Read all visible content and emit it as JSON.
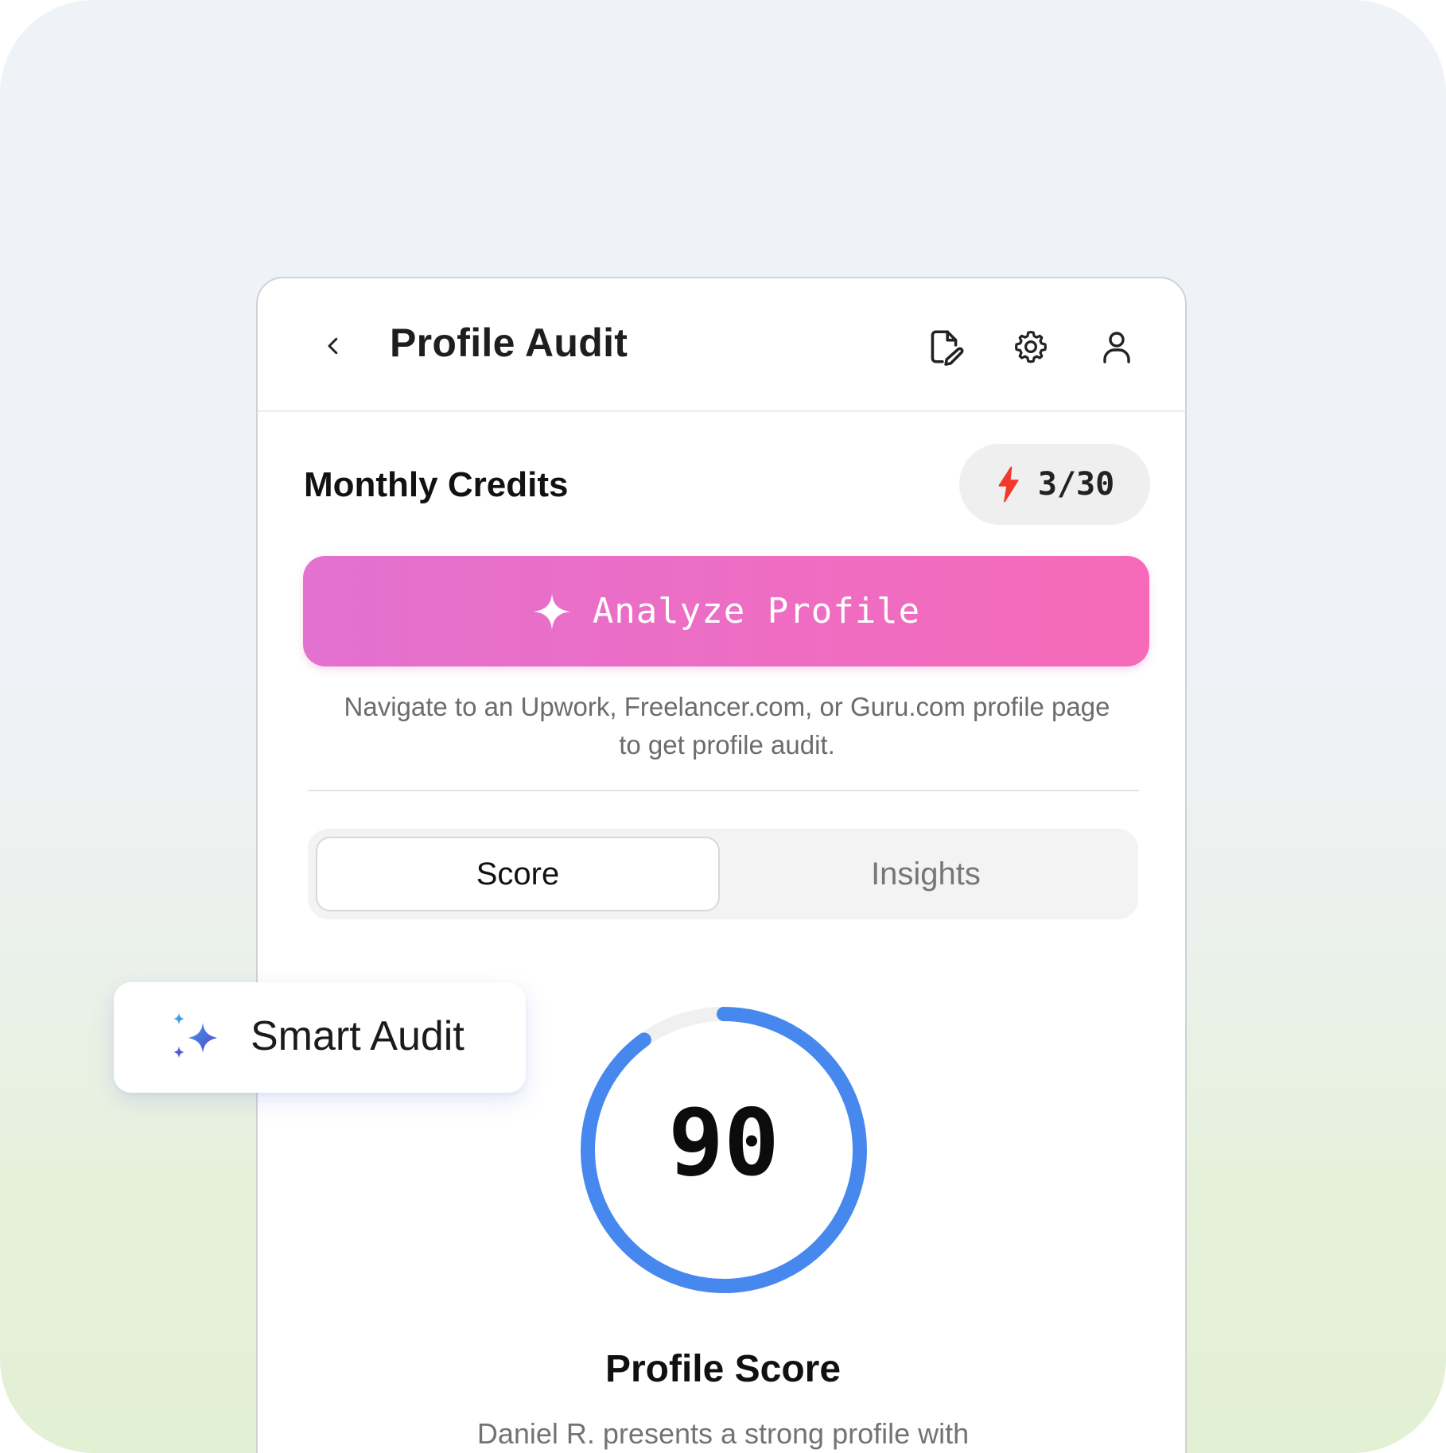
{
  "header": {
    "title": "Profile Audit",
    "icons": [
      "chevron-left-icon",
      "edit-document-icon",
      "gear-icon",
      "user-icon"
    ]
  },
  "credits": {
    "label": "Monthly Credits",
    "value": "3/30",
    "icon": "lightning-bolt-icon",
    "icon_color": "#f2392b"
  },
  "analyze": {
    "label": "Analyze Profile",
    "icon": "sparkle-icon",
    "gradient": [
      "#e371cf",
      "#f66ab9"
    ]
  },
  "helper_text": {
    "line1": "Navigate to an Upwork, Freelancer.com, or Guru.com profile page",
    "line2": "to get profile audit."
  },
  "tabs": [
    {
      "label": "Score",
      "active": true
    },
    {
      "label": "Insights",
      "active": false
    }
  ],
  "score": {
    "value": 90,
    "display": "90",
    "max": 100,
    "ring_color": "#4788ef",
    "track_color": "#f0f0f0",
    "title": "Profile Score",
    "description": "Daniel R. presents a strong profile with"
  },
  "badge": {
    "label": "Smart Audit",
    "icon": "sparkles-icon",
    "icon_colors": [
      "#3ca0e0",
      "#5a3fd8"
    ]
  }
}
